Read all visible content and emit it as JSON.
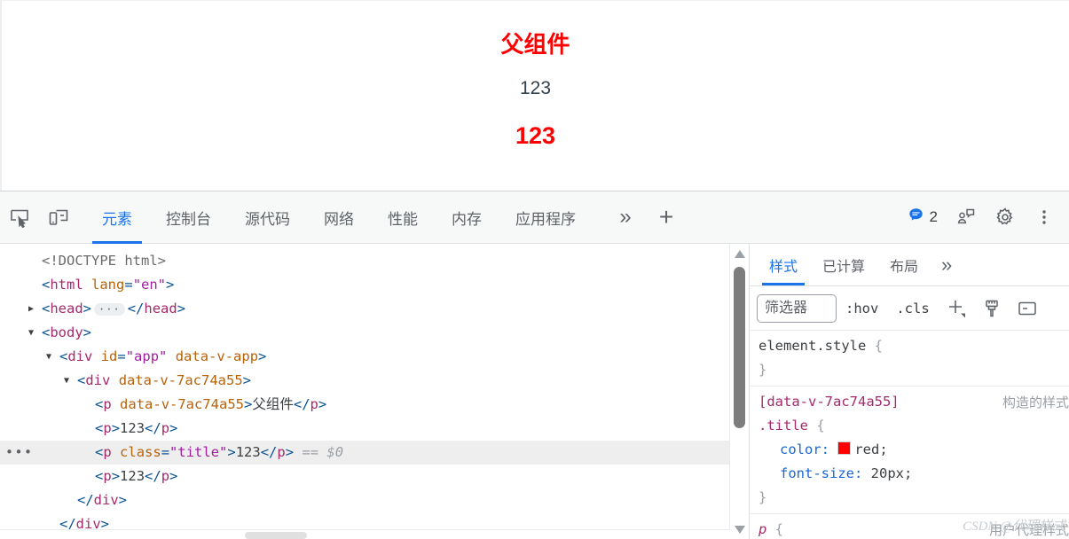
{
  "page": {
    "lines": [
      {
        "text": "父组件",
        "style": "parent"
      },
      {
        "text": "123",
        "style": "plain"
      },
      {
        "text": "123",
        "style": "title"
      }
    ]
  },
  "devtools": {
    "toolbar": {
      "icons": [
        "inspect-element-icon",
        "device-toolbar-icon"
      ],
      "tabs": [
        {
          "label": "元素",
          "active": true
        },
        {
          "label": "控制台",
          "active": false
        },
        {
          "label": "源代码",
          "active": false
        },
        {
          "label": "网络",
          "active": false
        },
        {
          "label": "性能",
          "active": false
        },
        {
          "label": "内存",
          "active": false
        },
        {
          "label": "应用程序",
          "active": false
        }
      ],
      "more_label": "»",
      "add_label": "+",
      "message_count": "2",
      "message_color": "#1a73e8"
    },
    "dom_tree": {
      "rows": [
        {
          "indent": 0,
          "triangle": "",
          "selected": false,
          "dots": false,
          "parts": [
            {
              "t": "doct",
              "v": "<!DOCTYPE html>"
            }
          ]
        },
        {
          "indent": 0,
          "triangle": "",
          "selected": false,
          "dots": false,
          "parts": [
            {
              "t": "pnc",
              "v": "<"
            },
            {
              "t": "tag",
              "v": "html"
            },
            {
              "t": "sp",
              "v": " "
            },
            {
              "t": "attr",
              "v": "lang"
            },
            {
              "t": "pnc",
              "v": "="
            },
            {
              "t": "val",
              "v": "\"en\""
            },
            {
              "t": "pnc",
              "v": ">"
            }
          ]
        },
        {
          "indent": 0,
          "triangle": "▶",
          "selected": false,
          "dots": false,
          "parts": [
            {
              "t": "pnc",
              "v": "<"
            },
            {
              "t": "tag",
              "v": "head"
            },
            {
              "t": "pnc",
              "v": ">"
            },
            {
              "t": "pill",
              "v": "···"
            },
            {
              "t": "pnc",
              "v": "</"
            },
            {
              "t": "tag",
              "v": "head"
            },
            {
              "t": "pnc",
              "v": ">"
            }
          ]
        },
        {
          "indent": 0,
          "triangle": "▼",
          "selected": false,
          "dots": false,
          "parts": [
            {
              "t": "pnc",
              "v": "<"
            },
            {
              "t": "tag",
              "v": "body"
            },
            {
              "t": "pnc",
              "v": ">"
            }
          ]
        },
        {
          "indent": 1,
          "triangle": "▼",
          "selected": false,
          "dots": false,
          "parts": [
            {
              "t": "pnc",
              "v": "<"
            },
            {
              "t": "tag",
              "v": "div"
            },
            {
              "t": "sp",
              "v": " "
            },
            {
              "t": "attr",
              "v": "id"
            },
            {
              "t": "pnc",
              "v": "="
            },
            {
              "t": "val",
              "v": "\"app\""
            },
            {
              "t": "sp",
              "v": " "
            },
            {
              "t": "attr",
              "v": "data-v-app"
            },
            {
              "t": "pnc",
              "v": ">"
            }
          ]
        },
        {
          "indent": 2,
          "triangle": "▼",
          "selected": false,
          "dots": false,
          "parts": [
            {
              "t": "pnc",
              "v": "<"
            },
            {
              "t": "tag",
              "v": "div"
            },
            {
              "t": "sp",
              "v": " "
            },
            {
              "t": "attr",
              "v": "data-v-7ac74a55"
            },
            {
              "t": "pnc",
              "v": ">"
            }
          ]
        },
        {
          "indent": 3,
          "triangle": "",
          "selected": false,
          "dots": false,
          "parts": [
            {
              "t": "pnc",
              "v": "<"
            },
            {
              "t": "tag",
              "v": "p"
            },
            {
              "t": "sp",
              "v": " "
            },
            {
              "t": "attr",
              "v": "data-v-7ac74a55"
            },
            {
              "t": "pnc",
              "v": ">"
            },
            {
              "t": "txt",
              "v": "父组件"
            },
            {
              "t": "pnc",
              "v": "</"
            },
            {
              "t": "tag",
              "v": "p"
            },
            {
              "t": "pnc",
              "v": ">"
            }
          ]
        },
        {
          "indent": 3,
          "triangle": "",
          "selected": false,
          "dots": false,
          "parts": [
            {
              "t": "pnc",
              "v": "<"
            },
            {
              "t": "tag",
              "v": "p"
            },
            {
              "t": "pnc",
              "v": ">"
            },
            {
              "t": "txt",
              "v": "123"
            },
            {
              "t": "pnc",
              "v": "</"
            },
            {
              "t": "tag",
              "v": "p"
            },
            {
              "t": "pnc",
              "v": ">"
            }
          ]
        },
        {
          "indent": 3,
          "triangle": "",
          "selected": true,
          "dots": true,
          "parts": [
            {
              "t": "pnc",
              "v": "<"
            },
            {
              "t": "tag",
              "v": "p"
            },
            {
              "t": "sp",
              "v": " "
            },
            {
              "t": "attr",
              "v": "class"
            },
            {
              "t": "pnc",
              "v": "="
            },
            {
              "t": "val",
              "v": "\"title\""
            },
            {
              "t": "pnc",
              "v": ">"
            },
            {
              "t": "txt",
              "v": "123"
            },
            {
              "t": "pnc",
              "v": "</"
            },
            {
              "t": "tag",
              "v": "p"
            },
            {
              "t": "pnc",
              "v": ">"
            },
            {
              "t": "sp",
              "v": " "
            },
            {
              "t": "eqs",
              "v": "== $0"
            }
          ]
        },
        {
          "indent": 3,
          "triangle": "",
          "selected": false,
          "dots": false,
          "parts": [
            {
              "t": "pnc",
              "v": "<"
            },
            {
              "t": "tag",
              "v": "p"
            },
            {
              "t": "pnc",
              "v": ">"
            },
            {
              "t": "txt",
              "v": "123"
            },
            {
              "t": "pnc",
              "v": "</"
            },
            {
              "t": "tag",
              "v": "p"
            },
            {
              "t": "pnc",
              "v": ">"
            }
          ]
        },
        {
          "indent": 2,
          "triangle": "",
          "selected": false,
          "dots": false,
          "parts": [
            {
              "t": "pnc",
              "v": "</"
            },
            {
              "t": "tag",
              "v": "div"
            },
            {
              "t": "pnc",
              "v": ">"
            }
          ]
        },
        {
          "indent": 1,
          "triangle": "",
          "selected": false,
          "dots": false,
          "parts": [
            {
              "t": "pnc",
              "v": "</"
            },
            {
              "t": "tag",
              "v": "div"
            },
            {
              "t": "pnc",
              "v": ">"
            }
          ]
        }
      ]
    },
    "styles": {
      "tabs": [
        {
          "label": "样式",
          "active": true
        },
        {
          "label": "已计算",
          "active": false
        },
        {
          "label": "布局",
          "active": false
        }
      ],
      "more_label": "»",
      "filter_placeholder": "筛选器",
      "filter_value": "",
      "hov_label": ":hov",
      "cls_label": ".cls",
      "new_rule_label": "+",
      "rules": [
        {
          "selector_parts": [
            {
              "t": "sel-el",
              "v": "element.style"
            }
          ],
          "origin": "",
          "declarations": []
        },
        {
          "selector_parts": [
            {
              "t": "sel-attr",
              "v": "[data-v-7ac74a55]"
            },
            {
              "t": "br",
              "v": ""
            },
            {
              "t": "sel-cls",
              "v": ".title"
            }
          ],
          "origin": "构造的样式",
          "declarations": [
            {
              "property": "color",
              "value": "red",
              "swatch": "#ff0000"
            },
            {
              "property": "font-size",
              "value": "20px",
              "swatch": ""
            }
          ]
        },
        {
          "selector_parts": [
            {
              "t": "sel-tag",
              "v": "p"
            }
          ],
          "origin": "用户代理样式",
          "declarations": []
        }
      ],
      "watermark": "CSDN @代理样式"
    }
  }
}
